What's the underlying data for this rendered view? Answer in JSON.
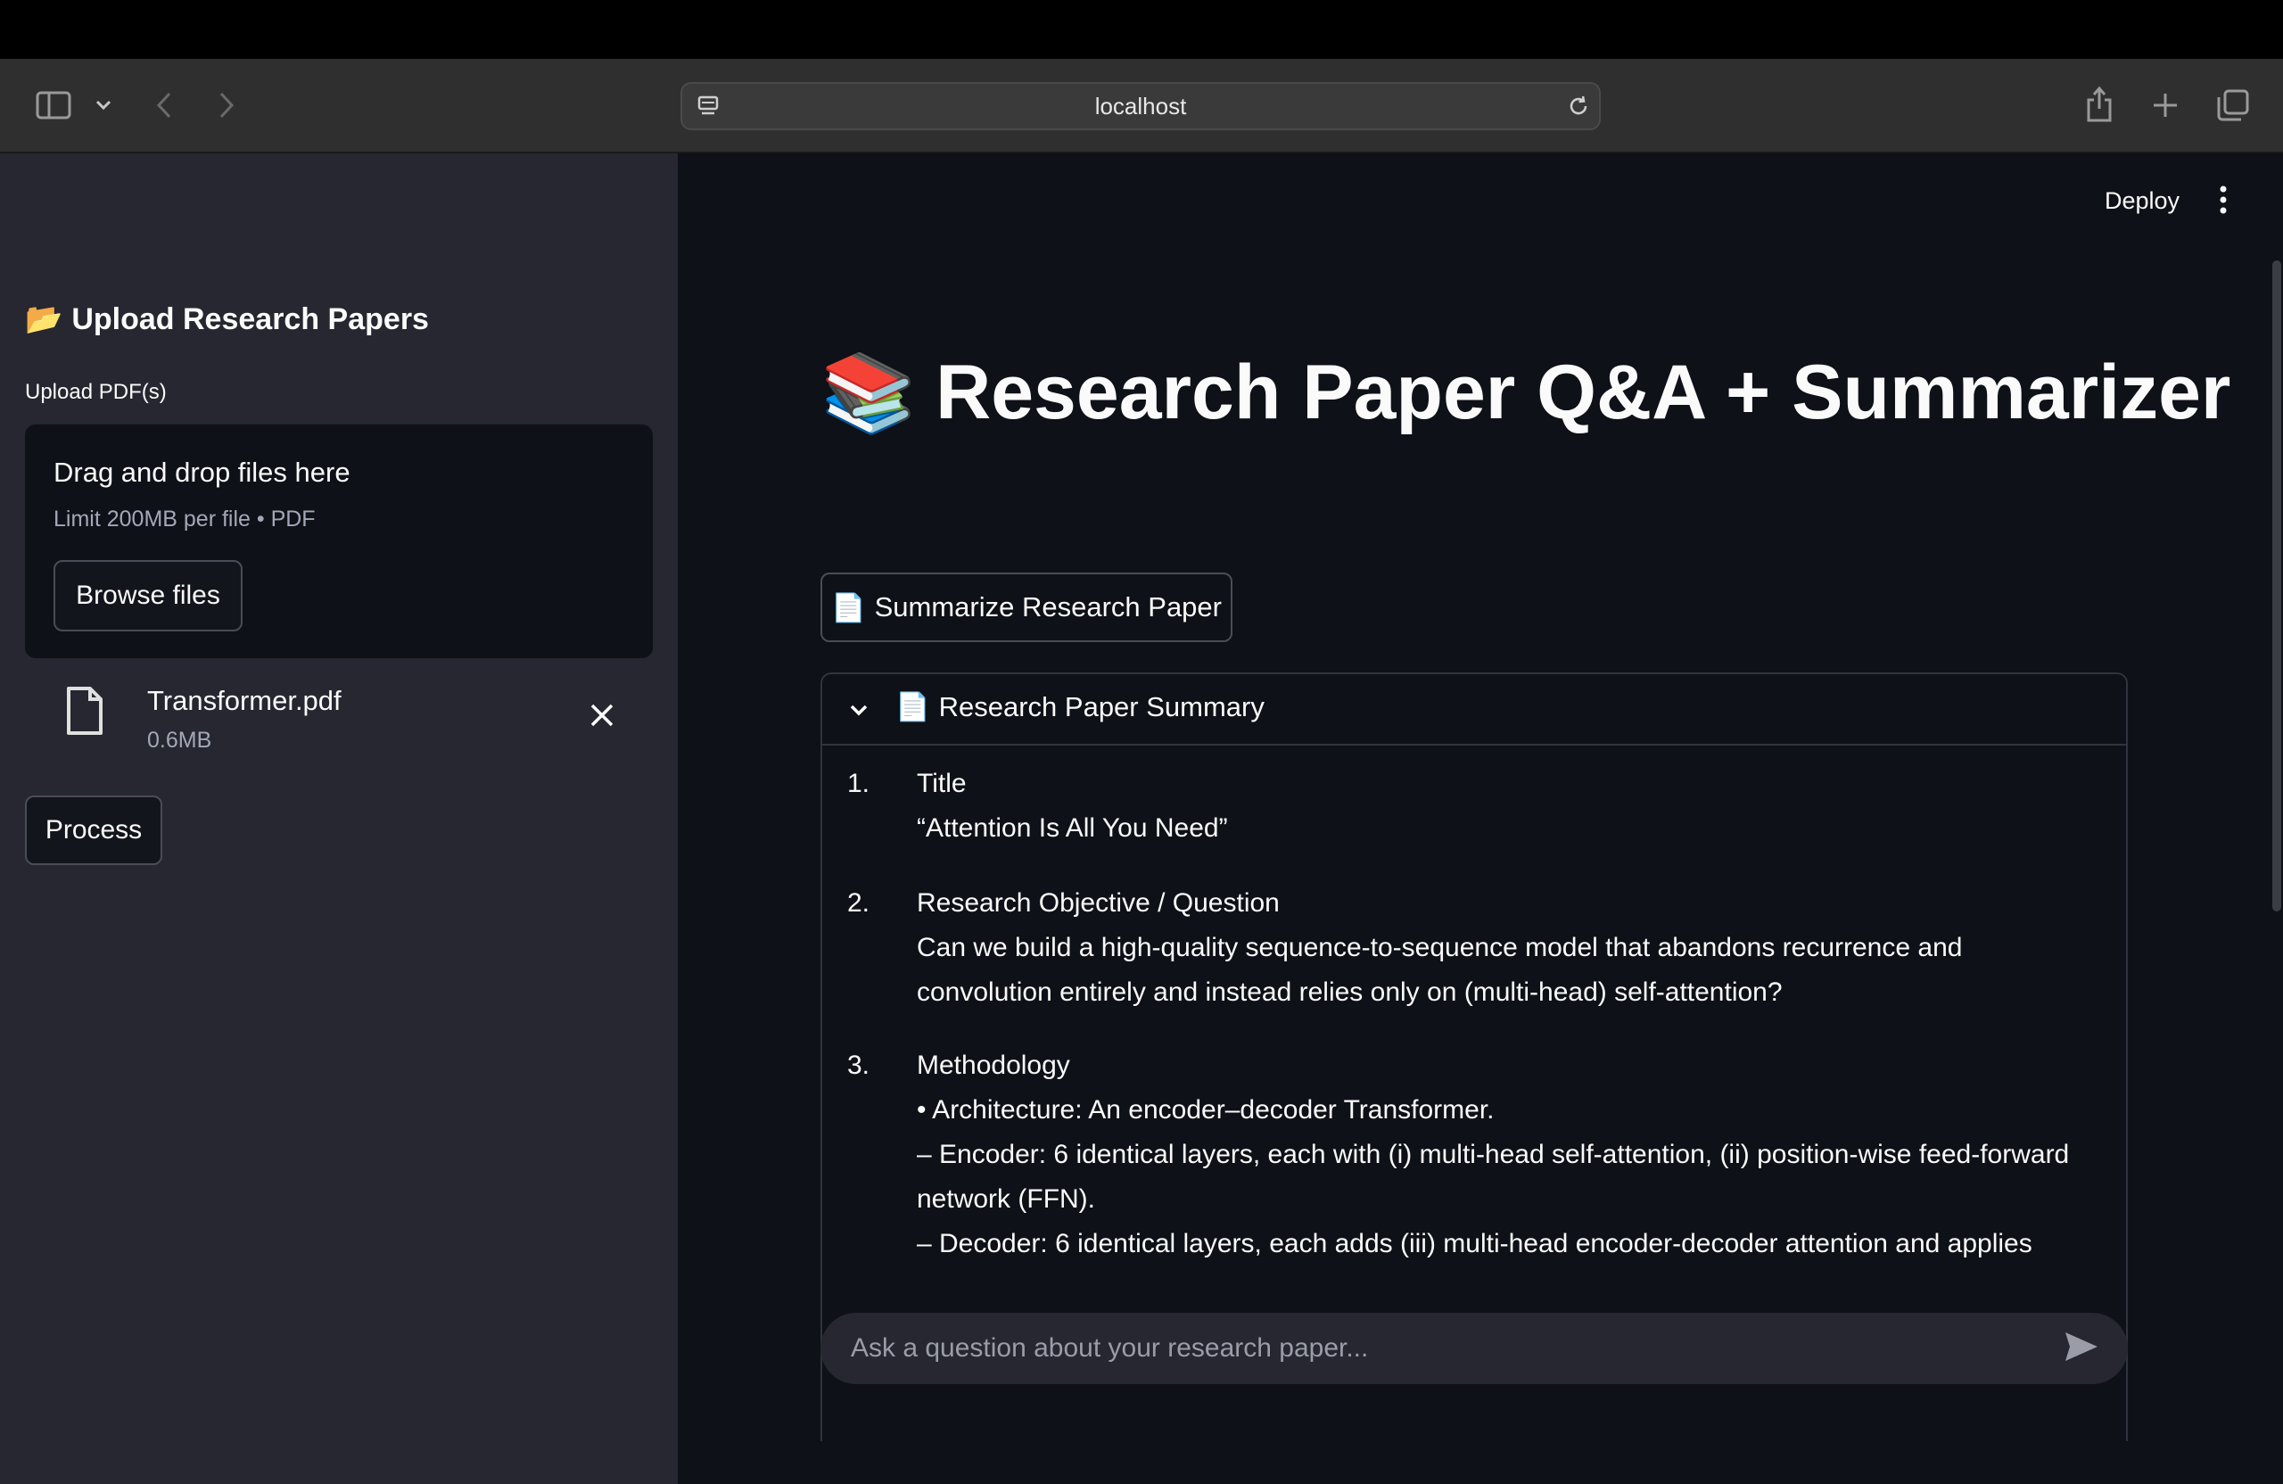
{
  "browser": {
    "url": "localhost"
  },
  "sidebar": {
    "heading_icon": "📂",
    "heading": "Upload Research Papers",
    "upload_label": "Upload PDF(s)",
    "dropzone": {
      "title": "Drag and drop files here",
      "subtitle": "Limit 200MB per file • PDF",
      "browse_label": "Browse files"
    },
    "file": {
      "name": "Transformer.pdf",
      "size": "0.6MB"
    },
    "process_label": "Process"
  },
  "header": {
    "deploy_label": "Deploy"
  },
  "main": {
    "title_icon": "📚",
    "title": "Research Paper Q&A + Summarizer",
    "summarize_icon": "📄",
    "summarize_label": "Summarize Research Paper",
    "expander": {
      "icon": "📄",
      "title": "Research Paper Summary",
      "items": [
        {
          "num": "1.",
          "heading": "Title",
          "lines": [
            "“Attention Is All You Need”"
          ]
        },
        {
          "num": "2.",
          "heading": "Research Objective / Question",
          "lines": [
            "Can we build a high-quality sequence-to-sequence model that abandons recurrence and convolution entirely and instead relies only on (multi-head) self-attention?"
          ]
        },
        {
          "num": "3.",
          "heading": "Methodology",
          "lines": [
            "• Architecture: An encoder–decoder Transformer.",
            "– Encoder: 6 identical layers, each with (i) multi-head self-attention, (ii) position-wise feed-forward network (FFN).",
            "– Decoder: 6 identical layers, each adds (iii) multi-head encoder-decoder attention and applies"
          ]
        }
      ]
    },
    "chat_placeholder": "Ask a question about your research paper..."
  }
}
